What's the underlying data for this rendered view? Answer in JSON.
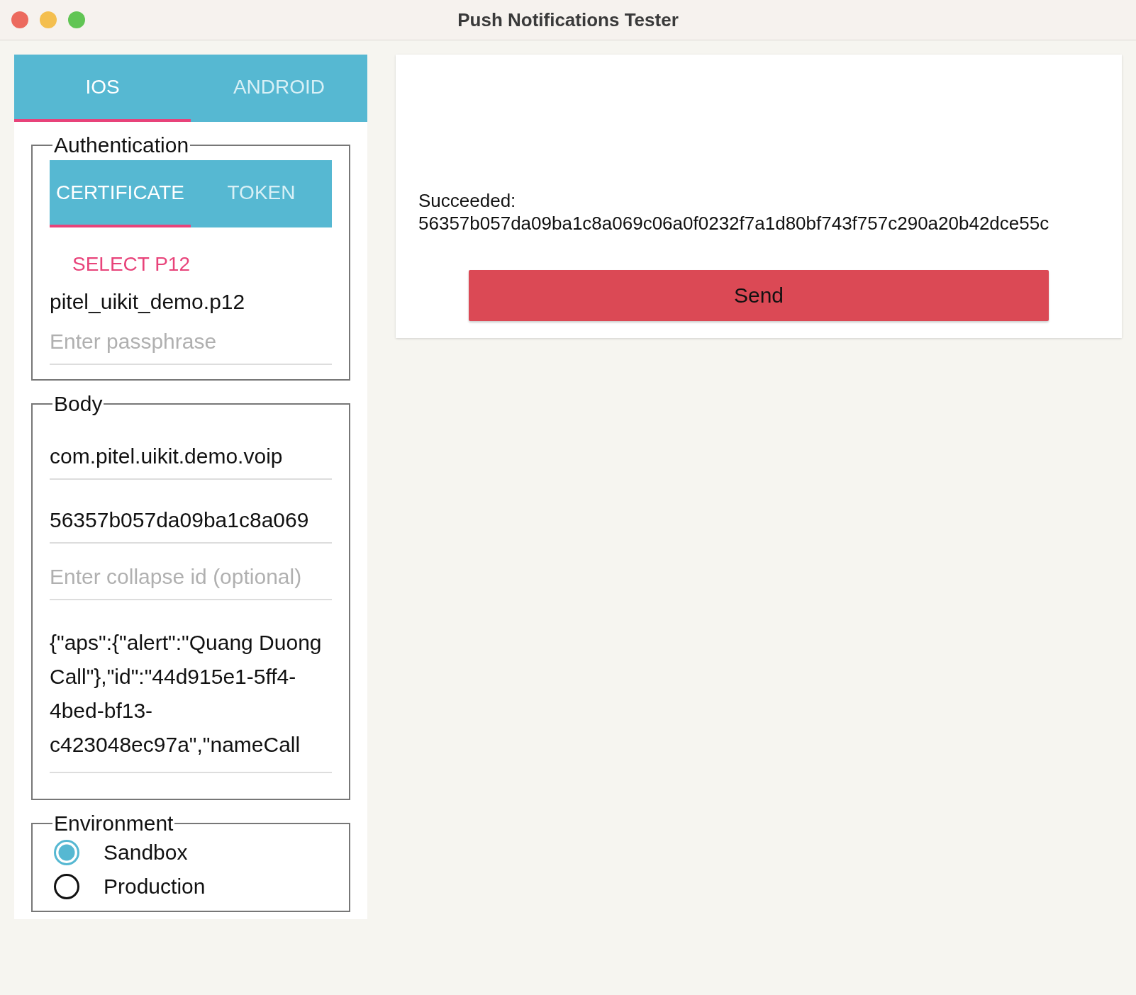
{
  "window": {
    "title": "Push Notifications Tester"
  },
  "platform_tabs": [
    {
      "label": "IOS",
      "selected": true
    },
    {
      "label": "ANDROID",
      "selected": false
    }
  ],
  "authentication": {
    "legend": "Authentication",
    "tabs": [
      {
        "label": "CERTIFICATE",
        "selected": true
      },
      {
        "label": "TOKEN",
        "selected": false
      }
    ],
    "select_button": "SELECT P12",
    "file_name": "pitel_uikit_demo.p12",
    "passphrase": {
      "placeholder": "Enter passphrase"
    }
  },
  "body": {
    "legend": "Body",
    "topic": {
      "value": "com.pitel.uikit.demo.voip"
    },
    "device_token": {
      "value": "56357b057da09ba1c8a069"
    },
    "collapse_id": {
      "placeholder": "Enter collapse id (optional)"
    },
    "payload": {
      "value": "{\"aps\":{\"alert\":\"Quang Duong Call\"},\"id\":\"44d915e1-5ff4-4bed-bf13-c423048ec97a\",\"nameCall"
    }
  },
  "environment": {
    "legend": "Environment",
    "options": [
      {
        "label": "Sandbox",
        "selected": true
      },
      {
        "label": "Production",
        "selected": false
      }
    ]
  },
  "result": {
    "status": "Succeeded:",
    "message": "56357b057da09ba1c8a069c06a0f0232f7a1d80bf743f757c290a20b42dce55c"
  },
  "send_button": "Send"
}
